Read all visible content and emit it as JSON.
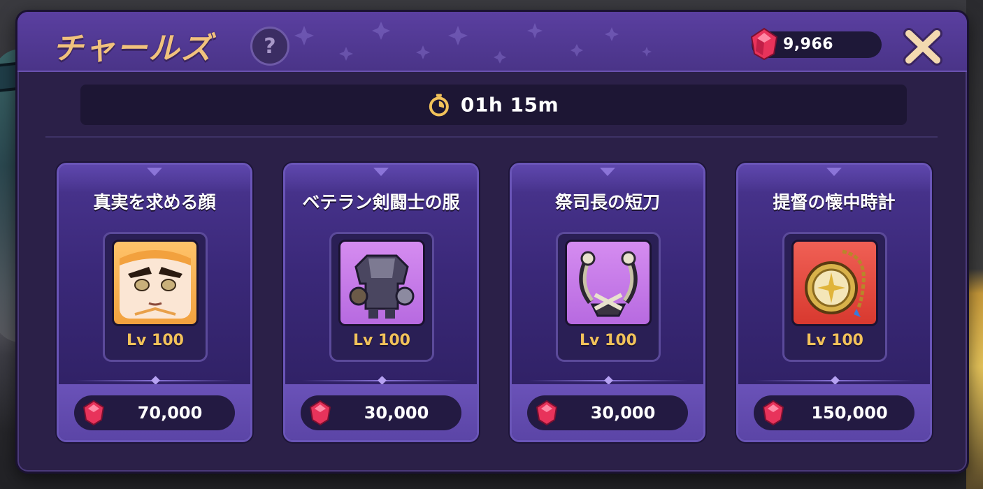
{
  "title": "チャールズ",
  "help_label": "?",
  "currency": {
    "icon": "red-gem-icon",
    "amount": "9,966"
  },
  "close_icon": "close-x-icon",
  "timer": {
    "icon": "stopwatch-icon",
    "remaining": "01h 15m"
  },
  "colors": {
    "accent_gold": "#f2c25a",
    "title_peach": "#f1c27d",
    "panel_purple": "#4a3590",
    "gem_red": "#e8335b"
  },
  "items": [
    {
      "name": "真実を求める顔",
      "level": "Lv 100",
      "price": "70,000",
      "icon": "face-icon",
      "tile": "orange"
    },
    {
      "name": "ベテラン剣闘士の服",
      "level": "Lv 100",
      "price": "30,000",
      "icon": "armor-icon",
      "tile": "purple"
    },
    {
      "name": "祭司長の短刀",
      "level": "Lv 100",
      "price": "30,000",
      "icon": "dagger-icon",
      "tile": "purple"
    },
    {
      "name": "提督の懐中時計",
      "level": "Lv 100",
      "price": "150,000",
      "icon": "pocket-watch-icon",
      "tile": "red"
    }
  ]
}
